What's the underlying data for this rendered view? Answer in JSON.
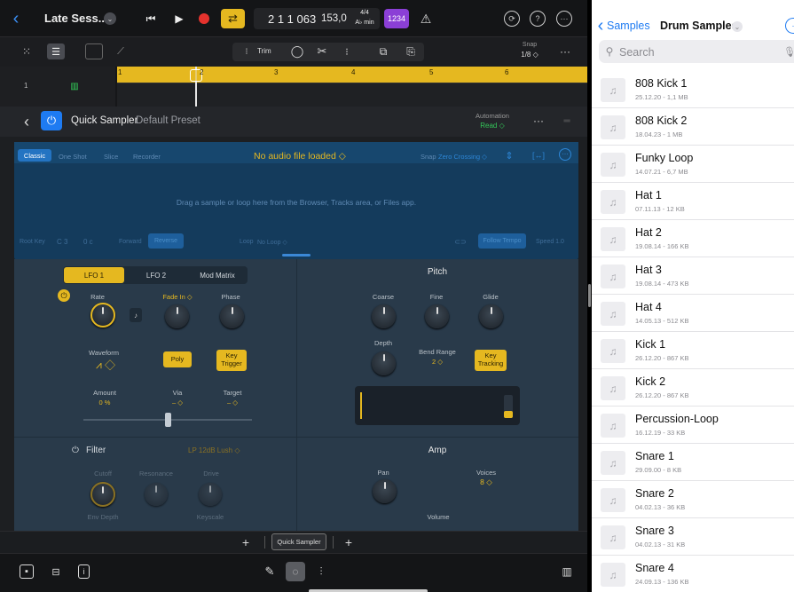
{
  "colors": {
    "accent_yellow": "#e5b820",
    "panel_blue": "#123a5a",
    "brand_blue": "#1e7bf2",
    "record_red": "#e5322d",
    "purple": "#8b3fd6"
  },
  "topbar": {
    "back_icon": "chevron-left-icon",
    "project_title": "Late Sess...",
    "position": "2 1 1 063",
    "tempo": "153,0",
    "time_signature": "4/4",
    "key": "A♭ min",
    "count_in": "1234"
  },
  "toolbar": {
    "trim_label": "Trim",
    "snap_label": "Snap",
    "snap_value": "1/8 ◇"
  },
  "ruler": {
    "bars": [
      "1",
      "2",
      "3",
      "4",
      "5",
      "6"
    ],
    "track_number": "1"
  },
  "plugin_header": {
    "name": "Quick Sampler",
    "preset": "Default Preset",
    "automation_label": "Automation",
    "automation_value": "Read ◇"
  },
  "sampler_top": {
    "modes": [
      "Classic",
      "One Shot",
      "Slice",
      "Recorder"
    ],
    "file_status": "No audio file loaded ◇",
    "snap_label": "Snap",
    "snap_value": "Zero Crossing ◇",
    "drop_hint": "Drag a sample or loop here from the Browser, Tracks area, or Files app.",
    "root_key_label": "Root Key",
    "root_key_value": "C 3",
    "tune_value": "0 c",
    "loop_label": "Loop",
    "loop_value": "No Loop ◇",
    "direction_labels": [
      "Forward",
      "Reverse"
    ],
    "follow_tempo": "Follow Tempo",
    "speed": "Speed 1.0"
  },
  "lfo": {
    "tabs": [
      "LFO 1",
      "LFO 2",
      "Mod Matrix"
    ],
    "rate_label": "Rate",
    "fade_label": "Fade In ◇",
    "phase_label": "Phase",
    "waveform_label": "Waveform",
    "poly_label": "Poly",
    "key_trigger_label": "Key Trigger",
    "amount_label": "Amount",
    "amount_value": "0 %",
    "via_label": "Via",
    "via_value": "– ◇",
    "target_label": "Target",
    "target_value": "– ◇"
  },
  "pitch": {
    "title": "Pitch",
    "coarse_label": "Coarse",
    "fine_label": "Fine",
    "glide_label": "Glide",
    "depth_label": "Depth",
    "bend_range_label": "Bend Range",
    "bend_range_value": "2 ◇",
    "key_tracking_label": "Key Tracking"
  },
  "filter": {
    "title": "Filter",
    "type": "LP 12dB Lush ◇",
    "cutoff_label": "Cutoff",
    "resonance_label": "Resonance",
    "drive_label": "Drive",
    "env_depth_label": "Env Depth",
    "keyscale_label": "Keyscale"
  },
  "amp": {
    "title": "Amp",
    "pan_label": "Pan",
    "voices_label": "Voices",
    "voices_value": "8 ◇",
    "volume_label": "Volume"
  },
  "plugin_footer": {
    "plugin_button": "Quick Sampler"
  },
  "browser": {
    "back_label": "Samples",
    "title": "Drum Samples",
    "search_placeholder": "Search",
    "files": [
      {
        "name": "808 Kick 1",
        "meta": "25.12.20 - 1,1 MB"
      },
      {
        "name": "808 Kick 2",
        "meta": "18.04.23 - 1 MB"
      },
      {
        "name": "Funky Loop",
        "meta": "14.07.21 - 6,7 MB"
      },
      {
        "name": "Hat 1",
        "meta": "07.11.13 - 12 KB"
      },
      {
        "name": "Hat 2",
        "meta": "19.08.14 - 166 KB"
      },
      {
        "name": "Hat 3",
        "meta": "19.08.14 - 473 KB"
      },
      {
        "name": "Hat 4",
        "meta": "14.05.13 - 512 KB"
      },
      {
        "name": "Kick 1",
        "meta": "26.12.20 - 867 KB"
      },
      {
        "name": "Kick 2",
        "meta": "26.12.20 - 867 KB"
      },
      {
        "name": "Percussion-Loop",
        "meta": "16.12.19 - 33 KB"
      },
      {
        "name": "Snare 1",
        "meta": "29.09.00 - 8 KB"
      },
      {
        "name": "Snare 2",
        "meta": "04.02.13 - 36 KB"
      },
      {
        "name": "Snare 3",
        "meta": "04.02.13 - 31 KB"
      },
      {
        "name": "Snare 4",
        "meta": "24.09.13 - 136 KB"
      }
    ]
  }
}
